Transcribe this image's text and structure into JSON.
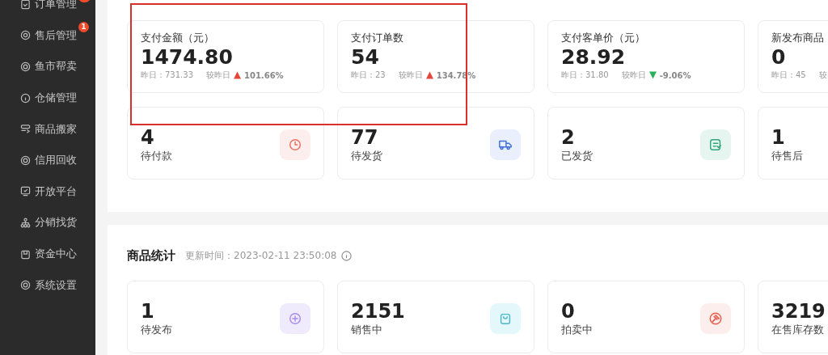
{
  "sidebar": {
    "items": [
      {
        "label": "订单管理",
        "badge_dot": true
      },
      {
        "label": "售后管理",
        "badge": "1"
      },
      {
        "label": "鱼市帮卖"
      },
      {
        "label": "仓储管理"
      },
      {
        "label": "商品搬家"
      },
      {
        "label": "信用回收"
      },
      {
        "label": "开放平台"
      },
      {
        "label": "分销找货"
      },
      {
        "label": "资金中心"
      },
      {
        "label": "系统设置"
      }
    ]
  },
  "order_stats": {
    "highlight_frame": true,
    "metrics": [
      {
        "label": "支付金额（元）",
        "value": "1474.80",
        "yesterday": "昨日：731.33",
        "compare_label": "较昨日",
        "kind": "up",
        "change": "101.66%"
      },
      {
        "label": "支付订单数",
        "value": "54",
        "yesterday": "昨日：23",
        "compare_label": "较昨日",
        "kind": "up",
        "change": "134.78%"
      },
      {
        "label": "支付客单价（元）",
        "value": "28.92",
        "yesterday": "昨日：31.80",
        "compare_label": "较昨日",
        "kind": "down",
        "change": "-9.06%"
      },
      {
        "label": "新发布商品",
        "value": "0",
        "yesterday": "昨日：45",
        "compare_label": "较"
      }
    ],
    "counts": [
      {
        "value": "4",
        "label": "待付款"
      },
      {
        "value": "77",
        "label": "待发货"
      },
      {
        "value": "2",
        "label": "已发货"
      },
      {
        "value": "1",
        "label": "待售后"
      }
    ]
  },
  "goods_stats": {
    "title": "商品统计",
    "updated": "更新时间：2023-02-11 23:50:08",
    "counts": [
      {
        "value": "1",
        "label": "待发布"
      },
      {
        "value": "2151",
        "label": "销售中"
      },
      {
        "value": "0",
        "label": "拍卖中"
      },
      {
        "value": "3219",
        "label": "在售库存数"
      }
    ]
  }
}
